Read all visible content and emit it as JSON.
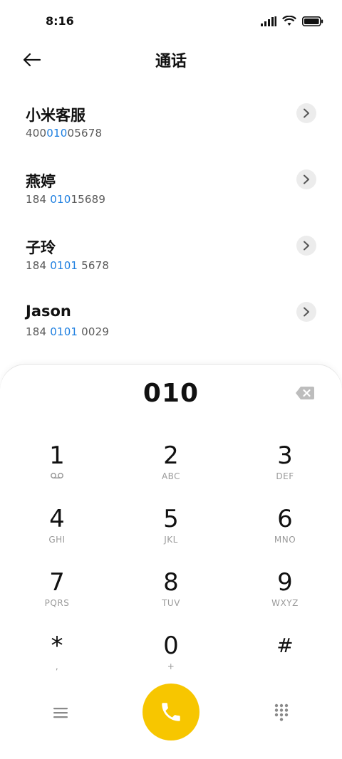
{
  "status": {
    "time": "8:16"
  },
  "header": {
    "title": "通话"
  },
  "contacts": [
    {
      "name": "小米客服",
      "num_pre": "400",
      "num_hl": "010",
      "num_post": "05678"
    },
    {
      "name": "燕婷",
      "num_pre": "184 ",
      "num_hl": "010",
      "num_post": "15689"
    },
    {
      "name": "子玲",
      "num_pre": "184 ",
      "num_hl": "0101",
      "num_post": " 5678"
    },
    {
      "name": "Jason",
      "num_pre": "184 ",
      "num_hl": "0101",
      "num_post": " 0029"
    }
  ],
  "dialpad": {
    "entered": "010",
    "keys": [
      {
        "digit": "1",
        "letters": ""
      },
      {
        "digit": "2",
        "letters": "ABC"
      },
      {
        "digit": "3",
        "letters": "DEF"
      },
      {
        "digit": "4",
        "letters": "GHI"
      },
      {
        "digit": "5",
        "letters": "JKL"
      },
      {
        "digit": "6",
        "letters": "MNO"
      },
      {
        "digit": "7",
        "letters": "PQRS"
      },
      {
        "digit": "8",
        "letters": "TUV"
      },
      {
        "digit": "9",
        "letters": "WXYZ"
      },
      {
        "digit": "*",
        "letters": ","
      },
      {
        "digit": "0",
        "letters": "+"
      },
      {
        "digit": "#",
        "letters": ""
      }
    ]
  },
  "colors": {
    "accent_call": "#f7c600",
    "highlight": "#1e7fe0"
  }
}
